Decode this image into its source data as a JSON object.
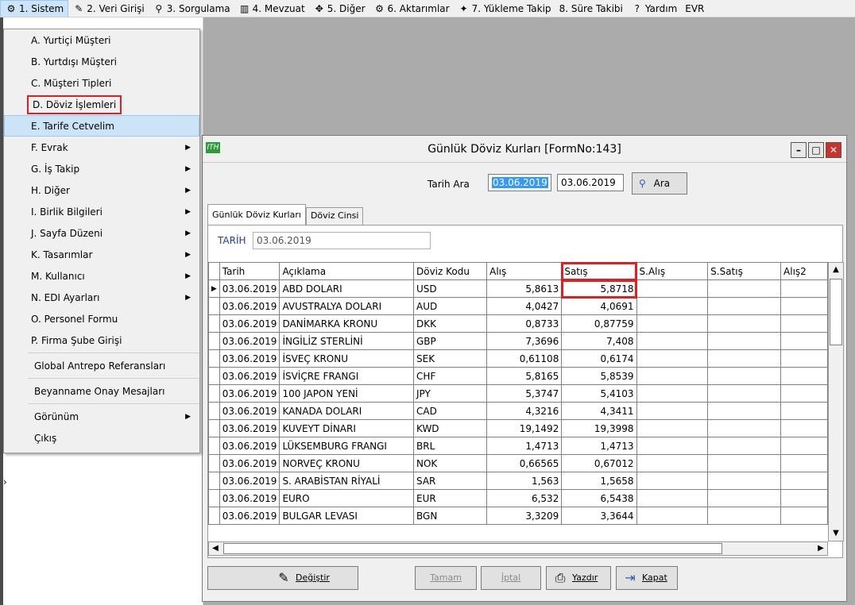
{
  "menubar": {
    "items": [
      {
        "label": "1. Sistem",
        "icon": "gear-icon"
      },
      {
        "label": "2. Veri Girişi",
        "icon": "pencil-icon"
      },
      {
        "label": "3. Sorgulama",
        "icon": "magnifier-icon"
      },
      {
        "label": "4. Mevzuat",
        "icon": "books-icon"
      },
      {
        "label": "5. Diğer",
        "icon": "puzzle-icon"
      },
      {
        "label": "6. Aktarımlar",
        "icon": "gears-icon"
      },
      {
        "label": "7. Yükleme Takip",
        "icon": "wrench-icon"
      },
      {
        "label": "8. Süre Takibi",
        "icon": ""
      },
      {
        "label": "Yardım",
        "icon": "help-icon"
      },
      {
        "label": "EVR",
        "icon": ""
      }
    ]
  },
  "sistem_menu": {
    "items": [
      {
        "label": "A.  Yurtiçi Müşteri",
        "sub": false
      },
      {
        "label": "B.  Yurtdışı Müşteri",
        "sub": false
      },
      {
        "label": "C.  Müşteri Tipleri",
        "sub": false
      },
      {
        "label": "D.  Döviz İşlemleri",
        "sub": false
      },
      {
        "label": "E.  Tarife Cetvelim",
        "sub": false
      },
      {
        "label": "F.  Evrak",
        "sub": true
      },
      {
        "label": "G.  İş Takip",
        "sub": true
      },
      {
        "label": "H.  Diğer",
        "sub": true
      },
      {
        "label": "I.  Birlik Bilgileri",
        "sub": true
      },
      {
        "label": "J.  Sayfa Düzeni",
        "sub": true
      },
      {
        "label": "K.  Tasarımlar",
        "sub": true
      },
      {
        "label": "M.  Kullanıcı",
        "sub": true
      },
      {
        "label": "N.  EDI Ayarları",
        "sub": true
      },
      {
        "label": "O.  Personel Formu",
        "sub": false
      },
      {
        "label": "P.   Firma Şube Girişi",
        "sub": false
      },
      {
        "label": "Global Antrepo Referansları",
        "sub": false
      },
      {
        "label": "Beyanname Onay Mesajları",
        "sub": false
      },
      {
        "label": "Görünüm",
        "sub": true
      },
      {
        "label": "Çıkış",
        "sub": false
      }
    ]
  },
  "form": {
    "title": "Günlük Döviz Kurları [FormNo:143]",
    "search_label": "Tarih Ara",
    "date_from": "03.06.2019",
    "date_to": "03.06.2019",
    "search_button": "Ara",
    "tabs": [
      "Günlük Döviz Kurları",
      "Döviz Cinsi"
    ],
    "tarih_label": "TARİH",
    "tarih_value": "03.06.2019",
    "columns": [
      "Tarih",
      "Açıklama",
      "Döviz Kodu",
      "Alış",
      "Satış",
      "S.Alış",
      "S.Satış",
      "Alış2"
    ],
    "rows": [
      [
        "03.06.2019",
        "ABD DOLARI",
        "USD",
        "5,8613",
        "5,8718"
      ],
      [
        "03.06.2019",
        "AVUSTRALYA DOLARI",
        "AUD",
        "4,0427",
        "4,0691"
      ],
      [
        "03.06.2019",
        "DANİMARKA KRONU",
        "DKK",
        "0,8733",
        "0,87759"
      ],
      [
        "03.06.2019",
        "İNGİLİZ STERLİNİ",
        "GBP",
        "7,3696",
        "7,408"
      ],
      [
        "03.06.2019",
        "İSVEÇ KRONU",
        "SEK",
        "0,61108",
        "0,6174"
      ],
      [
        "03.06.2019",
        "İSVİÇRE FRANGI",
        "CHF",
        "5,8165",
        "5,8539"
      ],
      [
        "03.06.2019",
        "100 JAPON YENİ",
        "JPY",
        "5,3747",
        "5,4103"
      ],
      [
        "03.06.2019",
        "KANADA DOLARI",
        "CAD",
        "4,3216",
        "4,3411"
      ],
      [
        "03.06.2019",
        "KUVEYT DİNARI",
        "KWD",
        "19,1492",
        "19,3998"
      ],
      [
        "03.06.2019",
        "LÜKSEMBURG FRANGI",
        "BRL",
        "1,4713",
        "1,4713"
      ],
      [
        "03.06.2019",
        "NORVEÇ KRONU",
        "NOK",
        "0,66565",
        "0,67012"
      ],
      [
        "03.06.2019",
        "S. ARABİSTAN RİYALİ",
        "SAR",
        "1,563",
        "1,5658"
      ],
      [
        "03.06.2019",
        "EURO",
        "EUR",
        "6,532",
        "6,5438"
      ],
      [
        "03.06.2019",
        "BULGAR LEVASI",
        "BGN",
        "3,3209",
        "3,3644"
      ]
    ],
    "buttons": {
      "degistir": "Değiştir",
      "tamam": "Tamam",
      "iptal": "İptal",
      "yazdir": "Yazdır",
      "kapat": "Kapat"
    }
  },
  "colors": {
    "highlight_box": "#e02020",
    "selection": "#3399ff",
    "menu_hover": "#cce4f7"
  }
}
